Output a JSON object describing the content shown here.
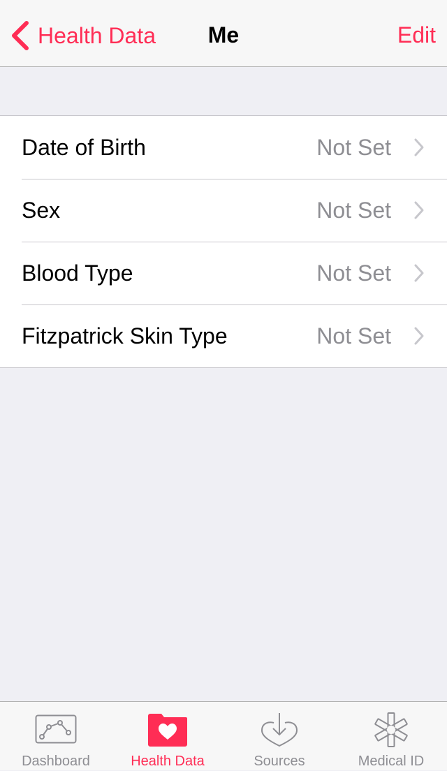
{
  "nav": {
    "back_label": "Health Data",
    "title": "Me",
    "edit_label": "Edit"
  },
  "rows": [
    {
      "label": "Date of Birth",
      "value": "Not Set"
    },
    {
      "label": "Sex",
      "value": "Not Set"
    },
    {
      "label": "Blood Type",
      "value": "Not Set"
    },
    {
      "label": "Fitzpatrick Skin Type",
      "value": "Not Set"
    }
  ],
  "tabs": [
    {
      "label": "Dashboard",
      "icon": "dashboard-chart-icon"
    },
    {
      "label": "Health Data",
      "icon": "health-data-folder-heart-icon",
      "active": true
    },
    {
      "label": "Sources",
      "icon": "sources-heart-arrow-icon"
    },
    {
      "label": "Medical ID",
      "icon": "medical-id-asterisk-icon"
    }
  ],
  "colors": {
    "accent": "#ff2d55",
    "secondary_text": "#8e8e93",
    "background": "#efeff4"
  }
}
